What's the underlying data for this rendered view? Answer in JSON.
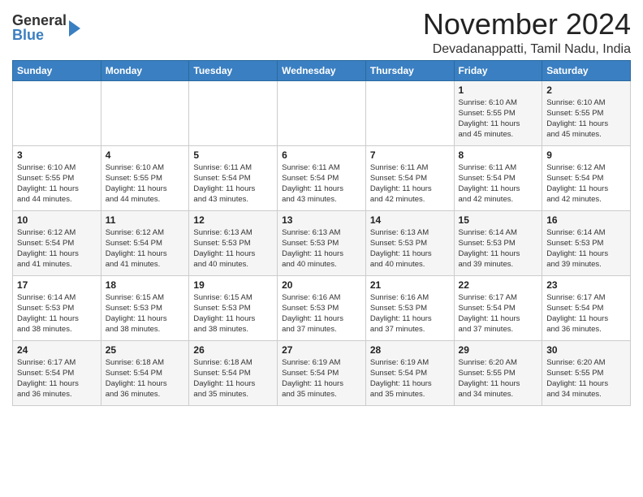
{
  "header": {
    "logo_general": "General",
    "logo_blue": "Blue",
    "month_title": "November 2024",
    "location": "Devadanappatti, Tamil Nadu, India"
  },
  "weekdays": [
    "Sunday",
    "Monday",
    "Tuesday",
    "Wednesday",
    "Thursday",
    "Friday",
    "Saturday"
  ],
  "weeks": [
    [
      {
        "day": "",
        "info": ""
      },
      {
        "day": "",
        "info": ""
      },
      {
        "day": "",
        "info": ""
      },
      {
        "day": "",
        "info": ""
      },
      {
        "day": "",
        "info": ""
      },
      {
        "day": "1",
        "info": "Sunrise: 6:10 AM\nSunset: 5:55 PM\nDaylight: 11 hours\nand 45 minutes."
      },
      {
        "day": "2",
        "info": "Sunrise: 6:10 AM\nSunset: 5:55 PM\nDaylight: 11 hours\nand 45 minutes."
      }
    ],
    [
      {
        "day": "3",
        "info": "Sunrise: 6:10 AM\nSunset: 5:55 PM\nDaylight: 11 hours\nand 44 minutes."
      },
      {
        "day": "4",
        "info": "Sunrise: 6:10 AM\nSunset: 5:55 PM\nDaylight: 11 hours\nand 44 minutes."
      },
      {
        "day": "5",
        "info": "Sunrise: 6:11 AM\nSunset: 5:54 PM\nDaylight: 11 hours\nand 43 minutes."
      },
      {
        "day": "6",
        "info": "Sunrise: 6:11 AM\nSunset: 5:54 PM\nDaylight: 11 hours\nand 43 minutes."
      },
      {
        "day": "7",
        "info": "Sunrise: 6:11 AM\nSunset: 5:54 PM\nDaylight: 11 hours\nand 42 minutes."
      },
      {
        "day": "8",
        "info": "Sunrise: 6:11 AM\nSunset: 5:54 PM\nDaylight: 11 hours\nand 42 minutes."
      },
      {
        "day": "9",
        "info": "Sunrise: 6:12 AM\nSunset: 5:54 PM\nDaylight: 11 hours\nand 42 minutes."
      }
    ],
    [
      {
        "day": "10",
        "info": "Sunrise: 6:12 AM\nSunset: 5:54 PM\nDaylight: 11 hours\nand 41 minutes."
      },
      {
        "day": "11",
        "info": "Sunrise: 6:12 AM\nSunset: 5:54 PM\nDaylight: 11 hours\nand 41 minutes."
      },
      {
        "day": "12",
        "info": "Sunrise: 6:13 AM\nSunset: 5:53 PM\nDaylight: 11 hours\nand 40 minutes."
      },
      {
        "day": "13",
        "info": "Sunrise: 6:13 AM\nSunset: 5:53 PM\nDaylight: 11 hours\nand 40 minutes."
      },
      {
        "day": "14",
        "info": "Sunrise: 6:13 AM\nSunset: 5:53 PM\nDaylight: 11 hours\nand 40 minutes."
      },
      {
        "day": "15",
        "info": "Sunrise: 6:14 AM\nSunset: 5:53 PM\nDaylight: 11 hours\nand 39 minutes."
      },
      {
        "day": "16",
        "info": "Sunrise: 6:14 AM\nSunset: 5:53 PM\nDaylight: 11 hours\nand 39 minutes."
      }
    ],
    [
      {
        "day": "17",
        "info": "Sunrise: 6:14 AM\nSunset: 5:53 PM\nDaylight: 11 hours\nand 38 minutes."
      },
      {
        "day": "18",
        "info": "Sunrise: 6:15 AM\nSunset: 5:53 PM\nDaylight: 11 hours\nand 38 minutes."
      },
      {
        "day": "19",
        "info": "Sunrise: 6:15 AM\nSunset: 5:53 PM\nDaylight: 11 hours\nand 38 minutes."
      },
      {
        "day": "20",
        "info": "Sunrise: 6:16 AM\nSunset: 5:53 PM\nDaylight: 11 hours\nand 37 minutes."
      },
      {
        "day": "21",
        "info": "Sunrise: 6:16 AM\nSunset: 5:53 PM\nDaylight: 11 hours\nand 37 minutes."
      },
      {
        "day": "22",
        "info": "Sunrise: 6:17 AM\nSunset: 5:54 PM\nDaylight: 11 hours\nand 37 minutes."
      },
      {
        "day": "23",
        "info": "Sunrise: 6:17 AM\nSunset: 5:54 PM\nDaylight: 11 hours\nand 36 minutes."
      }
    ],
    [
      {
        "day": "24",
        "info": "Sunrise: 6:17 AM\nSunset: 5:54 PM\nDaylight: 11 hours\nand 36 minutes."
      },
      {
        "day": "25",
        "info": "Sunrise: 6:18 AM\nSunset: 5:54 PM\nDaylight: 11 hours\nand 36 minutes."
      },
      {
        "day": "26",
        "info": "Sunrise: 6:18 AM\nSunset: 5:54 PM\nDaylight: 11 hours\nand 35 minutes."
      },
      {
        "day": "27",
        "info": "Sunrise: 6:19 AM\nSunset: 5:54 PM\nDaylight: 11 hours\nand 35 minutes."
      },
      {
        "day": "28",
        "info": "Sunrise: 6:19 AM\nSunset: 5:54 PM\nDaylight: 11 hours\nand 35 minutes."
      },
      {
        "day": "29",
        "info": "Sunrise: 6:20 AM\nSunset: 5:55 PM\nDaylight: 11 hours\nand 34 minutes."
      },
      {
        "day": "30",
        "info": "Sunrise: 6:20 AM\nSunset: 5:55 PM\nDaylight: 11 hours\nand 34 minutes."
      }
    ]
  ]
}
